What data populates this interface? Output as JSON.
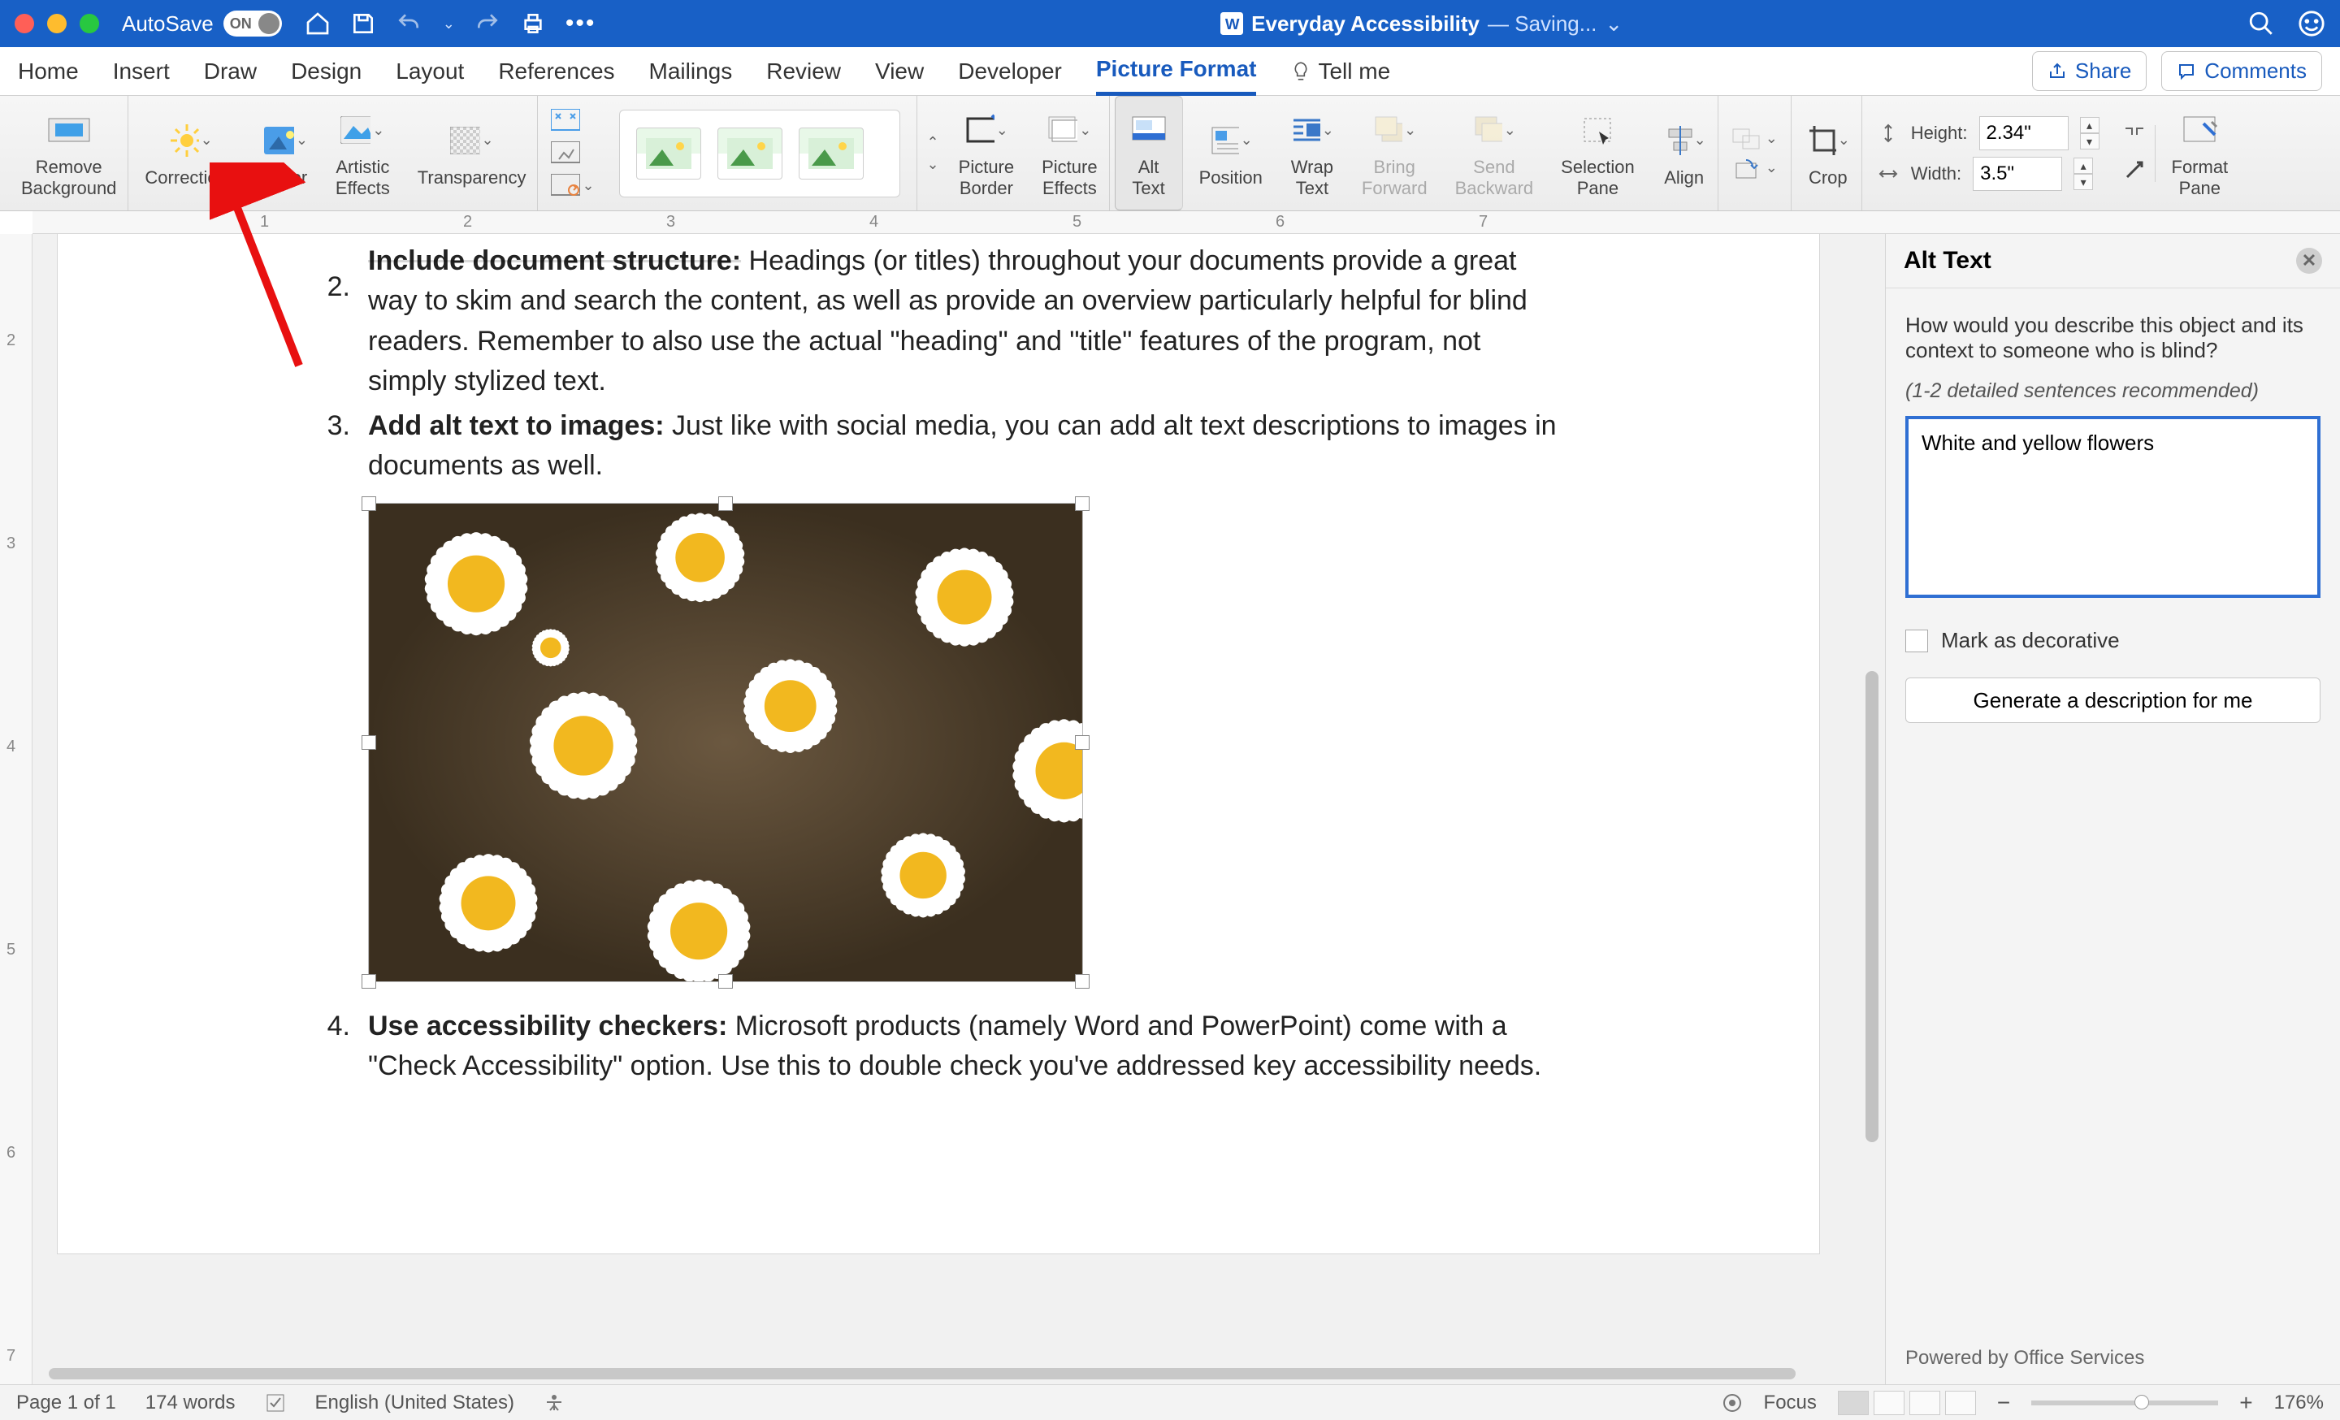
{
  "titlebar": {
    "autosave_label": "AutoSave",
    "autosave_state": "ON",
    "doc_icon": "word-doc-icon",
    "doc_title": "Everyday Accessibility",
    "doc_status": "— Saving..."
  },
  "tabs": {
    "items": [
      "Home",
      "Insert",
      "Draw",
      "Design",
      "Layout",
      "References",
      "Mailings",
      "Review",
      "View",
      "Developer",
      "Picture Format"
    ],
    "active_index": 10,
    "tell_me": "Tell me",
    "share": "Share",
    "comments": "Comments"
  },
  "ribbon": {
    "remove_bg": "Remove\nBackground",
    "corrections": "Corrections",
    "color": "Color",
    "artistic": "Artistic\nEffects",
    "transparency": "Transparency",
    "picture_border": "Picture\nBorder",
    "picture_effects": "Picture\nEffects",
    "alt_text": "Alt\nText",
    "position": "Position",
    "wrap_text": "Wrap\nText",
    "bring_forward": "Bring\nForward",
    "send_backward": "Send\nBackward",
    "selection_pane": "Selection\nPane",
    "align": "Align",
    "crop": "Crop",
    "height_label": "Height:",
    "height_value": "2.34\"",
    "width_label": "Width:",
    "width_value": "3.5\"",
    "format_pane": "Format\nPane"
  },
  "ruler_h": [
    "1",
    "2",
    "3",
    "4",
    "5",
    "6",
    "7"
  ],
  "ruler_v": [
    "2",
    "3",
    "4",
    "5",
    "6",
    "7"
  ],
  "document": {
    "item2_num": "2.",
    "item2_title": "Include document structure:",
    "item2_text": " Headings (or titles) throughout your documents provide a great way to skim and search the content, as well as provide an overview particularly helpful for blind readers. Remember to also use the actual \"heading\" and \"title\" features of the program, not simply stylized text.",
    "item3_num": "3.",
    "item3_title": "Add alt text to images:",
    "item3_text": " Just like with social media, you can add alt text descriptions to images in documents as well.",
    "item4_num": "4.",
    "item4_title": "Use accessibility checkers:",
    "item4_text": " Microsoft products (namely Word and PowerPoint) come with a \"Check Accessibility\" option. Use this to double check you've addressed key accessibility needs."
  },
  "alt_pane": {
    "title": "Alt Text",
    "question": "How would you describe this object and its context to someone who is blind?",
    "hint": "(1-2 detailed sentences recommended)",
    "value": "White and yellow flowers",
    "decorative": "Mark as decorative",
    "generate": "Generate a description for me",
    "footer": "Powered by Office Services"
  },
  "statusbar": {
    "page": "Page 1 of 1",
    "words": "174 words",
    "language": "English (United States)",
    "focus": "Focus",
    "zoom": "176%"
  }
}
